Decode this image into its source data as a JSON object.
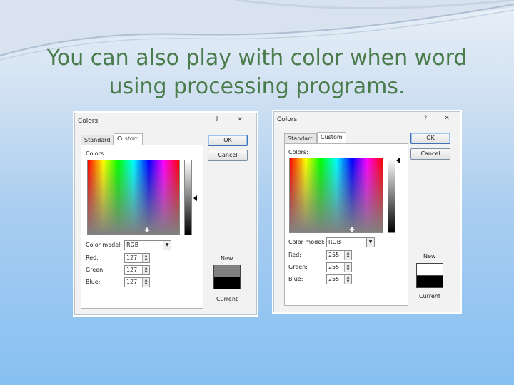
{
  "slide": {
    "title_line1": "You can also play with color when word",
    "title_line2": "using processing programs."
  },
  "dialogs": [
    {
      "title": "Colors",
      "help_button": "?",
      "close_button": "✕",
      "tabs": [
        "Standard",
        "Custom"
      ],
      "active_tab": "Custom",
      "colors_label": "Colors:",
      "color_model_label": "Color model:",
      "color_model_value": "RGB",
      "red_label": "Red:",
      "red_value": "127",
      "green_label": "Green:",
      "green_value": "127",
      "blue_label": "Blue:",
      "blue_value": "127",
      "ok_label": "OK",
      "cancel_label": "Cancel",
      "new_label": "New",
      "current_label": "Current",
      "new_color": "#808080",
      "current_color": "#000000"
    },
    {
      "title": "Colors",
      "help_button": "?",
      "close_button": "✕",
      "tabs": [
        "Standard",
        "Custom"
      ],
      "active_tab": "Custom",
      "colors_label": "Colors:",
      "color_model_label": "Color model:",
      "color_model_value": "RGB",
      "red_label": "Red:",
      "red_value": "255",
      "green_label": "Green:",
      "green_value": "255",
      "blue_label": "Blue:",
      "blue_value": "255",
      "ok_label": "OK",
      "cancel_label": "Cancel",
      "new_label": "New",
      "current_label": "Current",
      "new_color": "#ffffff",
      "current_color": "#000000"
    }
  ]
}
